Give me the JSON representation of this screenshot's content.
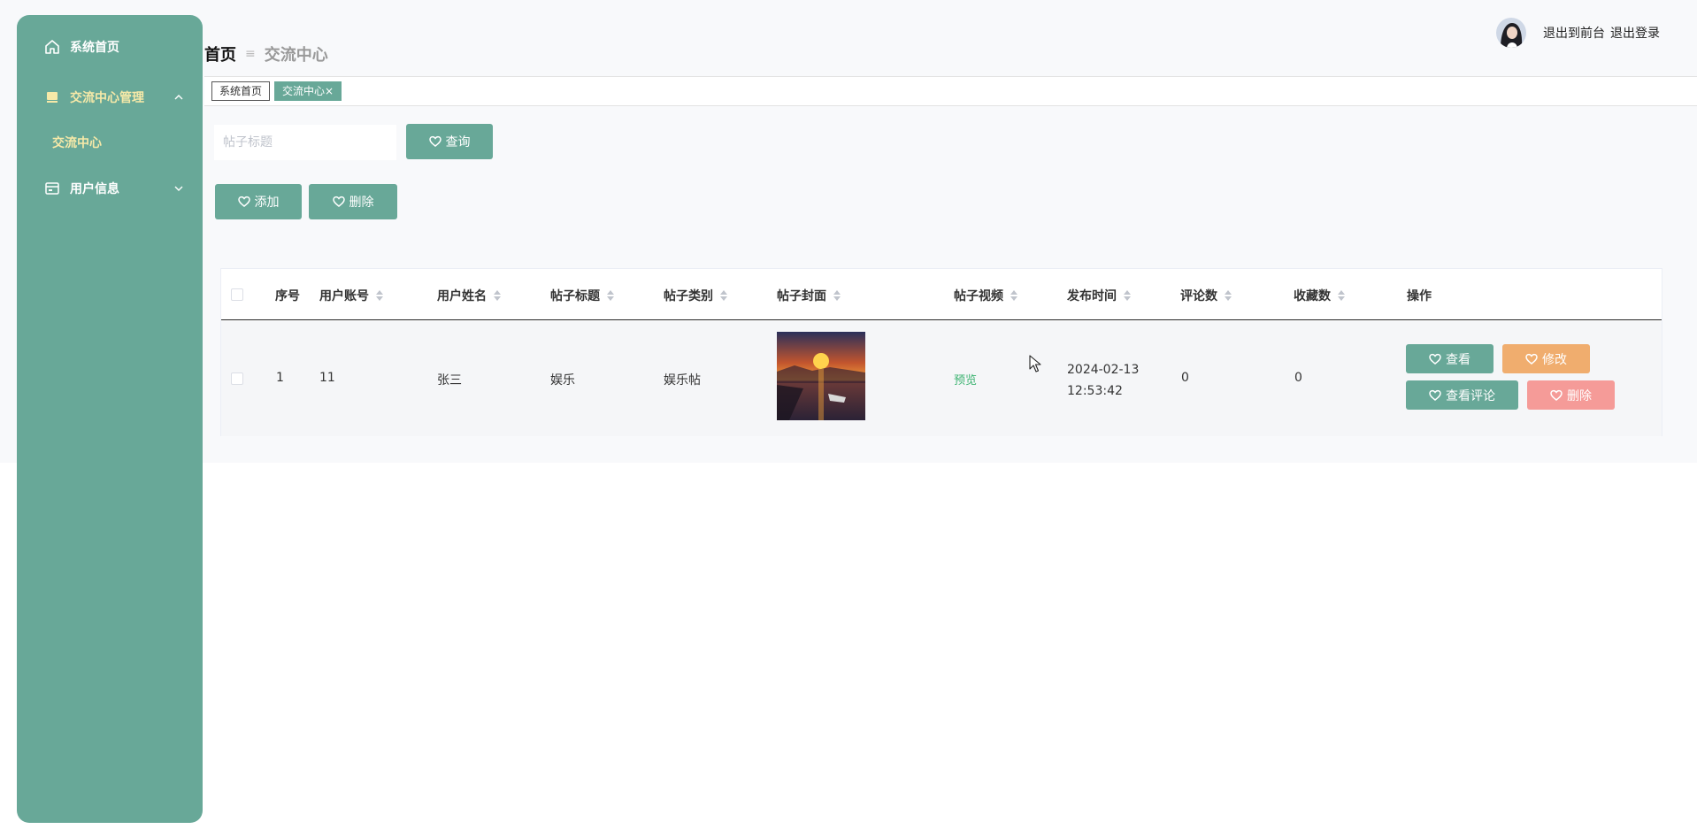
{
  "sidebar": {
    "items": [
      {
        "label": "系统首页",
        "icon": "home-icon"
      },
      {
        "label": "交流中心管理",
        "icon": "book-icon",
        "expanded": true,
        "children": [
          {
            "label": "交流中心"
          }
        ]
      },
      {
        "label": "用户信息",
        "icon": "card-icon",
        "expanded": false
      }
    ]
  },
  "header": {
    "breadcrumb": {
      "home": "首页",
      "separator": "≡",
      "current": "交流中心"
    },
    "links": {
      "front": "退出到前台",
      "logout": "退出登录"
    }
  },
  "tabs": [
    {
      "label": "系统首页"
    },
    {
      "label": "交流中心",
      "close": "×"
    }
  ],
  "search": {
    "placeholder": "帖子标题",
    "button": "查询"
  },
  "actions": {
    "add": "添加",
    "delete": "删除"
  },
  "table": {
    "columns": [
      "序号",
      "用户账号",
      "用户姓名",
      "帖子标题",
      "帖子类别",
      "帖子封面",
      "帖子视频",
      "发布时间",
      "评论数",
      "收藏数",
      "操作"
    ],
    "rows": [
      {
        "index": "1",
        "account": "11",
        "name": "张三",
        "title": "娱乐",
        "category": "娱乐帖",
        "video": "预览",
        "time": "2024-02-13 12:53:42",
        "comments": "0",
        "favorites": "0",
        "ops": {
          "view": "查看",
          "edit": "修改",
          "comments": "查看评论",
          "delete": "删除"
        }
      }
    ]
  },
  "colors": {
    "primary": "#68a898",
    "edit": "#f0ad6e",
    "danger": "#f59b98",
    "active_text": "#f6e9a8",
    "preview_link": "#3cb371"
  }
}
